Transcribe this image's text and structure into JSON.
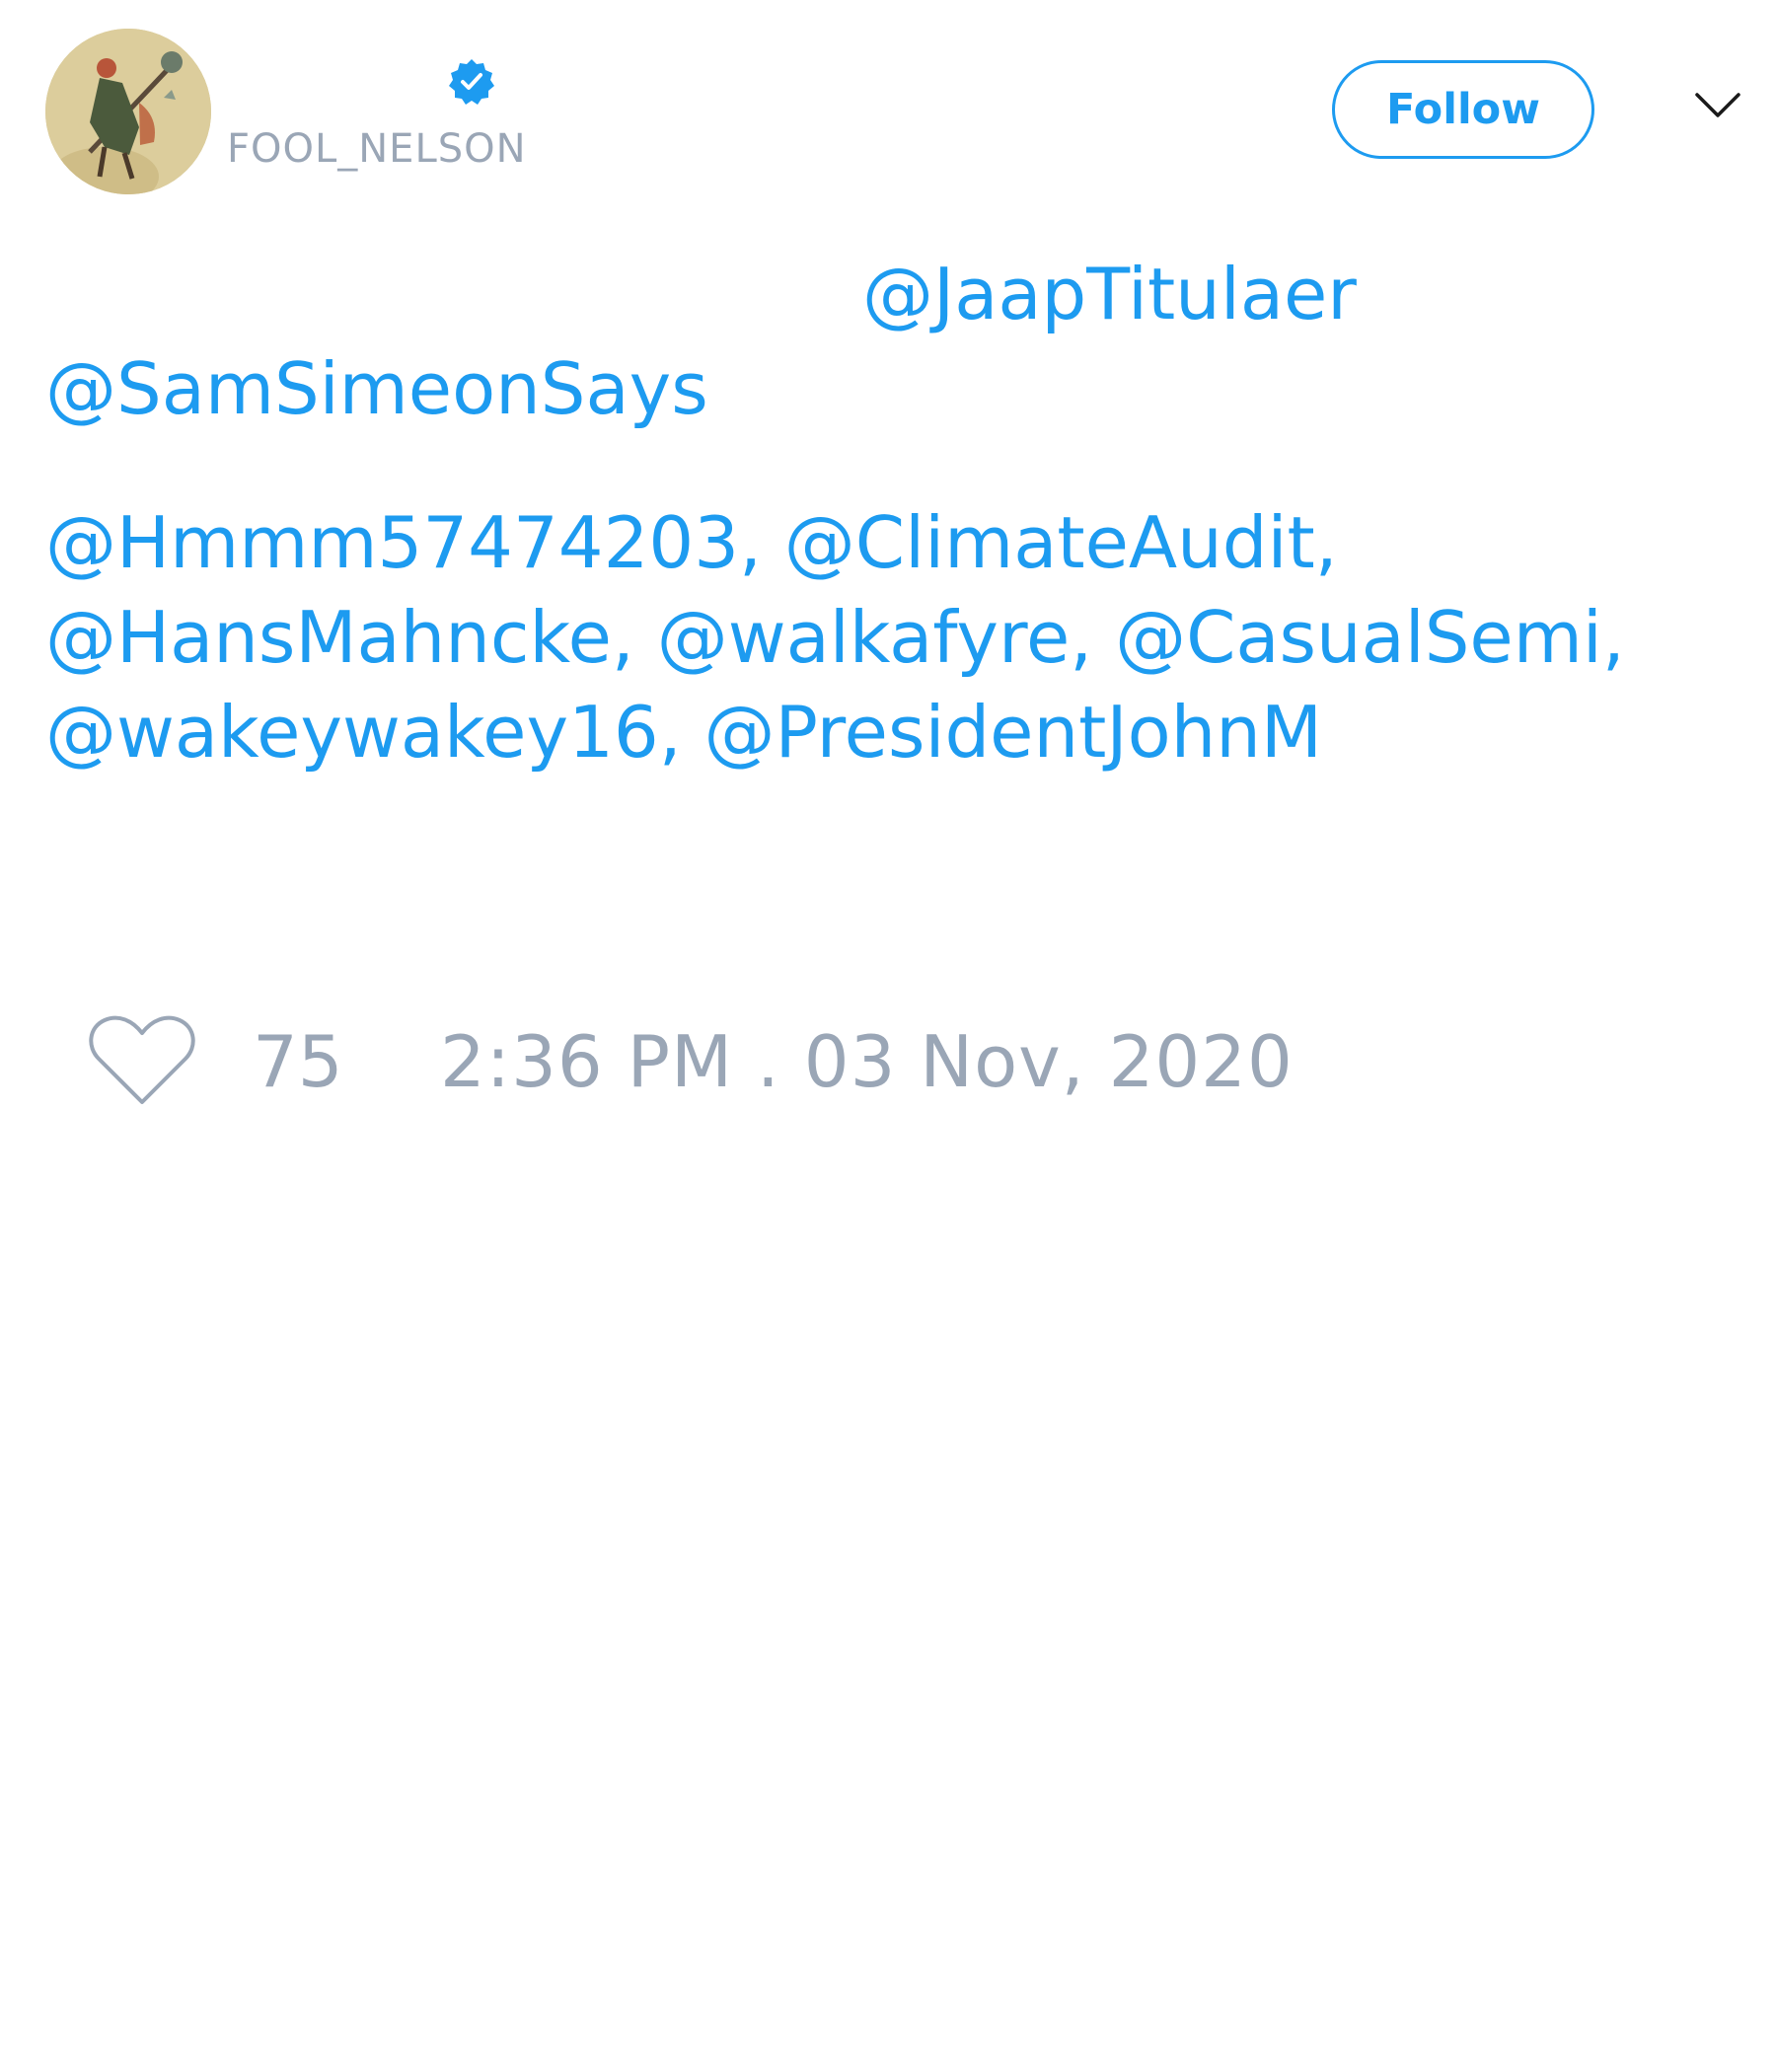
{
  "author": {
    "handle": "FOOL_NELSON",
    "verified": true,
    "avatar_icon": "avatar-image-icon"
  },
  "header": {
    "follow_label": "Follow",
    "menu_icon": "chevron-down-icon"
  },
  "tweet": {
    "mentions_line1": [
      "@JaapTitulaer"
    ],
    "mentions_line2": [
      "@SamSimeonSays"
    ],
    "mention_list": [
      "@Hmmm57474203,",
      "@ClimateAudit,",
      "@HansMahncke,",
      "@walkafyre,",
      "@CasualSemi,",
      "@wakeywakey16,",
      "@PresidentJohnM"
    ]
  },
  "footer": {
    "like_icon": "heart-icon",
    "like_count": "75",
    "timestamp": "2:36 PM . 03 Nov, 2020"
  },
  "colors": {
    "accent": "#1d9bf0",
    "muted": "#9aa6b6"
  }
}
